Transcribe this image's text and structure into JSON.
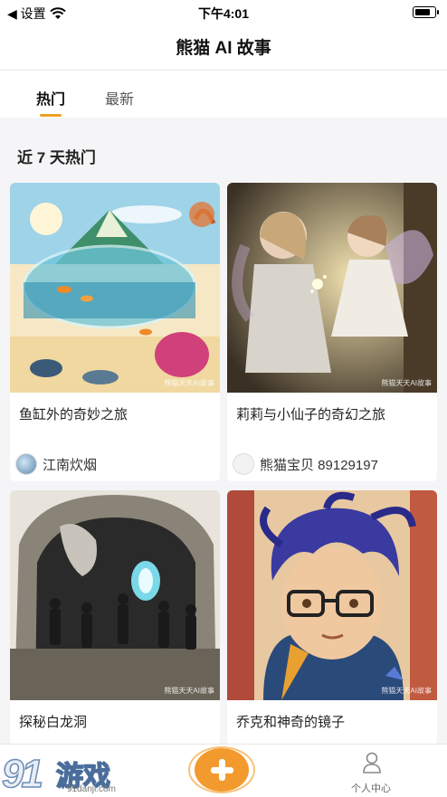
{
  "status_bar": {
    "back_label": "◀ 设置",
    "time": "下午4:01"
  },
  "header": {
    "title": "熊猫 AI 故事"
  },
  "tabs": [
    {
      "label": "热门",
      "active": true
    },
    {
      "label": "最新",
      "active": false
    }
  ],
  "section": {
    "title": "近 7 天热门"
  },
  "cards": [
    {
      "title": "鱼缸外的奇妙之旅",
      "author": "江南炊烟",
      "watermark": "熊猫天天AI故事"
    },
    {
      "title": "莉莉与小仙子的奇幻之旅",
      "author": "熊猫宝贝 89129197",
      "watermark": "熊猫天天AI故事"
    },
    {
      "title": "探秘白龙洞",
      "author": "",
      "watermark": "熊猫天天AI故事"
    },
    {
      "title": "乔克和神奇的镜子",
      "author": "",
      "watermark": "熊猫天天AI故事"
    }
  ],
  "bottom_bar": {
    "watermark_logo": "91",
    "watermark_text": "游戏",
    "watermark_url": "91danji.com",
    "profile_label": "个人中心",
    "accent": "#f39a2e"
  }
}
